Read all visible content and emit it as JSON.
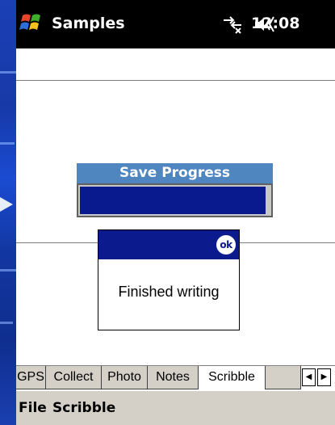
{
  "titlebar": {
    "title": "Samples",
    "time": "12:08"
  },
  "icons": {
    "start": "windows-start-icon",
    "connectivity": "connectivity-icon",
    "volume": "speaker-volume-icon",
    "ok": "ok-icon",
    "tab_left": "scroll-left-icon",
    "tab_right": "scroll-right-icon"
  },
  "progress": {
    "title": "Save Progress",
    "fraction": 0.98
  },
  "dialog": {
    "ok_label": "ok",
    "message": "Finished writing"
  },
  "tabs": [
    {
      "label": "GPS",
      "active": false
    },
    {
      "label": "Collect",
      "active": false
    },
    {
      "label": "Photo",
      "active": false
    },
    {
      "label": "Notes",
      "active": false
    },
    {
      "label": "Scribble",
      "active": true
    }
  ],
  "menu": {
    "file": "File",
    "scribble": "Scribble"
  },
  "colors": {
    "titlebar": "#000000",
    "progress_header": "#4f86bf",
    "progress_fill": "#081a8e",
    "dialog_header": "#0b1a8c",
    "tab_inactive": "#d4d0c8",
    "menubar": "#d4d0c8"
  }
}
